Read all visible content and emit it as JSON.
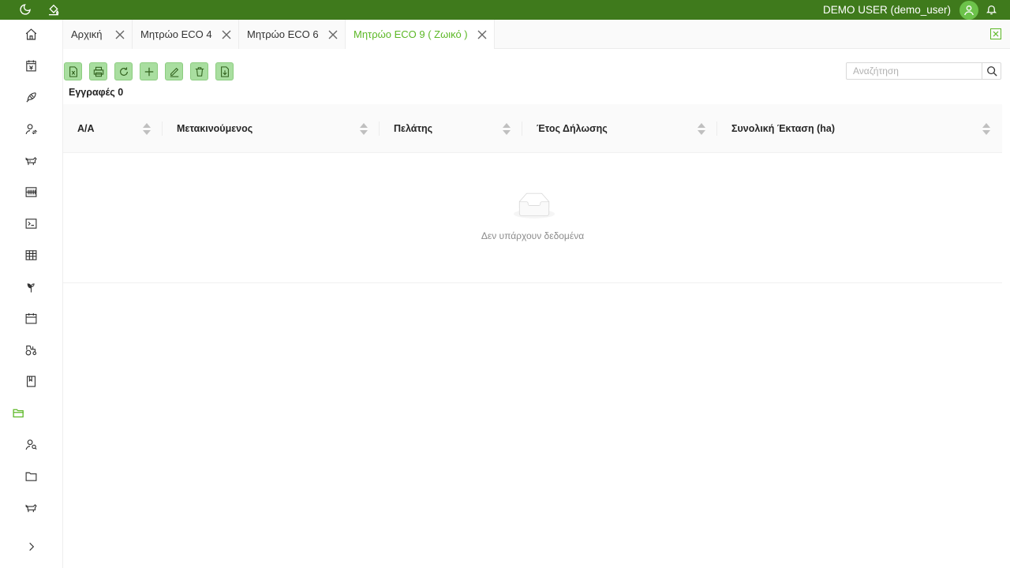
{
  "header": {
    "user_name": "DEMO USER (demo_user)",
    "icons": [
      "moon-icon",
      "paint-bucket-icon",
      "user-avatar-icon",
      "bell-icon"
    ],
    "brand_color": "#3f7a1c"
  },
  "sidebar": {
    "items": [
      {
        "icon": "home-icon"
      },
      {
        "icon": "invoice-icon"
      },
      {
        "icon": "feather-icon"
      },
      {
        "icon": "user-sync-icon"
      },
      {
        "icon": "livestock-icon"
      },
      {
        "icon": "barcode-icon"
      },
      {
        "icon": "terminal-icon"
      },
      {
        "icon": "table-icon"
      },
      {
        "icon": "plant-icon"
      },
      {
        "icon": "calendar-icon"
      },
      {
        "icon": "tractor-icon"
      },
      {
        "icon": "book-icon"
      },
      {
        "icon": "folder-open-icon",
        "active": true
      },
      {
        "icon": "user-search-icon"
      },
      {
        "icon": "folder-icon"
      },
      {
        "icon": "animal-icon"
      }
    ],
    "expand_icon": "chevron-right-icon",
    "accent_color": "#5cb826"
  },
  "tabs": [
    {
      "label": "Αρχική"
    },
    {
      "label": "Μητρώο ECO 4"
    },
    {
      "label": "Μητρώο ECO 6"
    },
    {
      "label": "Μητρώο ECO 9 ( Ζωικό )",
      "active": true
    }
  ],
  "toolbar": {
    "buttons": [
      "export-excel-icon",
      "print-icon",
      "refresh-icon",
      "add-icon",
      "edit-icon",
      "delete-icon",
      "export-file-icon"
    ],
    "button_color": "#a9dea0"
  },
  "search": {
    "placeholder": "Αναζήτηση",
    "value": ""
  },
  "records": {
    "label": "Εγγραφές 0"
  },
  "table": {
    "columns": [
      {
        "label": "Α/Α"
      },
      {
        "label": "Μετακινούμενος"
      },
      {
        "label": "Πελάτης"
      },
      {
        "label": "Έτος Δήλωσης"
      },
      {
        "label": "Συνολική Έκταση (ha)"
      }
    ],
    "rows": [],
    "empty_text": "Δεν υπάρχουν δεδομένα"
  }
}
